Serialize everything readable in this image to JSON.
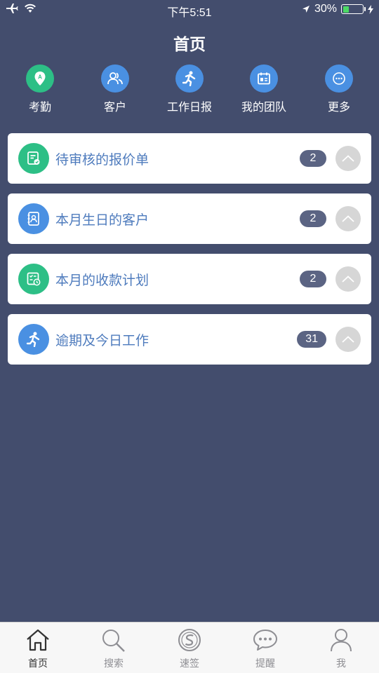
{
  "status_bar": {
    "time": "下午5:51",
    "battery": "30%",
    "battery_level": 0.3
  },
  "header": {
    "title": "首页"
  },
  "quick_nav": [
    {
      "label": "考勤",
      "icon": "location-pin-icon",
      "color": "#2dbf86"
    },
    {
      "label": "客户",
      "icon": "users-icon",
      "color": "#4a90e2"
    },
    {
      "label": "工作日报",
      "icon": "runner-icon",
      "color": "#4a90e2"
    },
    {
      "label": "我的团队",
      "icon": "calendar-team-icon",
      "color": "#4a90e2"
    },
    {
      "label": "更多",
      "icon": "more-icon",
      "color": "#4a90e2"
    }
  ],
  "cards": [
    {
      "title": "待审核的报价单",
      "count": "2",
      "icon": "quote-document-icon",
      "color": "#2dbf86"
    },
    {
      "title": "本月生日的客户",
      "count": "2",
      "icon": "contact-book-icon",
      "color": "#4a90e2"
    },
    {
      "title": "本月的收款计划",
      "count": "2",
      "icon": "payment-plan-icon",
      "color": "#2dbf86"
    },
    {
      "title": "逾期及今日工作",
      "count": "31",
      "icon": "runner-icon",
      "color": "#4a90e2"
    }
  ],
  "tab_bar": [
    {
      "label": "首页",
      "icon": "home-icon",
      "active": true
    },
    {
      "label": "搜索",
      "icon": "search-icon",
      "active": false
    },
    {
      "label": "速签",
      "icon": "quick-sign-icon",
      "active": false
    },
    {
      "label": "提醒",
      "icon": "chat-bubble-icon",
      "active": false
    },
    {
      "label": "我",
      "icon": "person-icon",
      "active": false
    }
  ],
  "colors": {
    "background": "#434d6d",
    "card_title": "#4e7bbd",
    "badge": "#5b6483",
    "toggle": "#d6d6d6",
    "green": "#2dbf86",
    "blue": "#4a90e2"
  }
}
